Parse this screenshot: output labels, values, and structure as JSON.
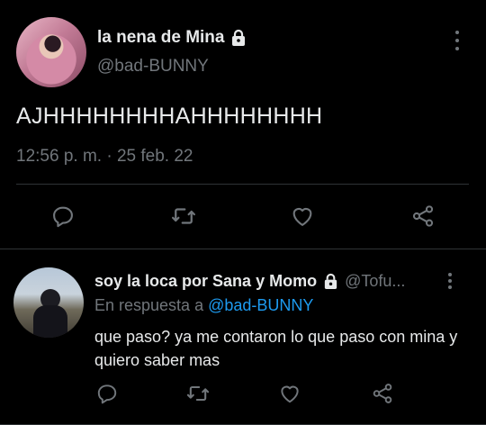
{
  "main_tweet": {
    "display_name": "la nena de Mina",
    "handle": "@bad-BUNNY",
    "text": "AJHHHHHHHHAHHHHHHHH",
    "timestamp": "12:56 p. m. · 25 feb. 22",
    "verified_lock": "lock-icon",
    "actions": [
      "reply-icon",
      "retweet-icon",
      "like-icon",
      "share-icon"
    ]
  },
  "reply_tweet": {
    "display_name": "soy la loca por Sana y Momo",
    "handle": "@Tofu...",
    "replying_prefix": "En respuesta a",
    "replying_mention": "@bad-BUNNY",
    "text": "que paso? ya me contaron lo que paso con mina y quiero saber mas",
    "actions": [
      "reply-icon",
      "retweet-icon",
      "like-icon",
      "share-icon"
    ]
  },
  "colors": {
    "background": "#000000",
    "text_primary": "#e7e9ea",
    "text_secondary": "#71767b",
    "accent": "#1d9bf0",
    "divider": "#2f3336"
  }
}
